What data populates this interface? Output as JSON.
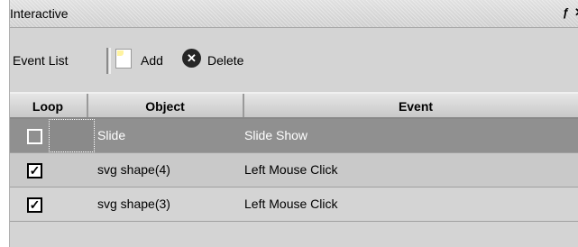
{
  "window": {
    "title": "Interactive",
    "icons": [
      "restore-icon",
      "close-icon"
    ],
    "icon_glyphs": [
      "ƒ",
      "✕"
    ]
  },
  "toolbar": {
    "event_list_label": "Event List",
    "add_label": "Add",
    "delete_label": "Delete"
  },
  "table": {
    "columns": [
      "Loop",
      "Object",
      "Event"
    ],
    "rows": [
      {
        "loop": false,
        "object": "Slide",
        "event": "Slide Show",
        "selected": true
      },
      {
        "loop": true,
        "object": "svg shape(4)",
        "event": "Left Mouse Click",
        "selected": false
      },
      {
        "loop": true,
        "object": "svg shape(3)",
        "event": "Left Mouse Click",
        "selected": false
      }
    ]
  }
}
